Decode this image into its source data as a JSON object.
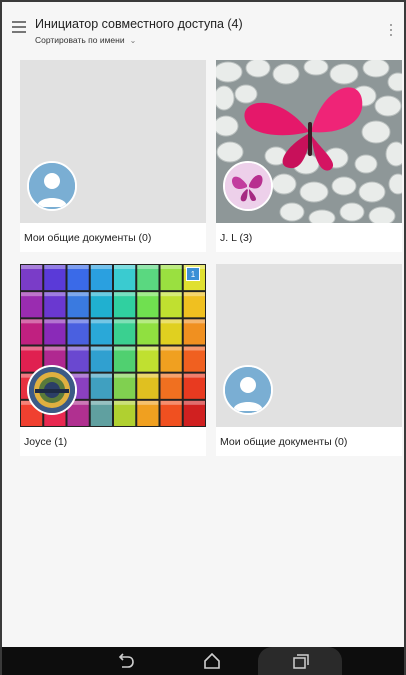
{
  "header": {
    "title": "Инициатор совместного доступа (4)",
    "sort_label": "Сортировать по имени",
    "menu_icon": "hamburger-icon",
    "more_icon": "more-vertical-icon"
  },
  "cards": [
    {
      "caption": "Мои общие документы (0)",
      "thumbnail": "empty",
      "avatar": "default-user-icon"
    },
    {
      "caption": "J. L (3)",
      "thumbnail": "pink-butterfly-on-pebbles",
      "avatar": "butterfly-avatar"
    },
    {
      "caption": "Joyce (1)",
      "thumbnail": "colorful-cubes",
      "avatar": "user-photo-avatar",
      "badge": "1"
    },
    {
      "caption": "Мои общие документы (0)",
      "thumbnail": "empty",
      "avatar": "default-user-icon"
    }
  ],
  "navbar": {
    "back_icon": "back-icon",
    "home_icon": "home-icon",
    "recents_icon": "recent-apps-icon"
  },
  "colors": {
    "background": "#f6f6f6",
    "avatar_blue": "#7aaed3",
    "badge_blue": "#3b8fd6",
    "butterfly_pink": "#e5186a",
    "navbar": "#0d0d0d"
  }
}
